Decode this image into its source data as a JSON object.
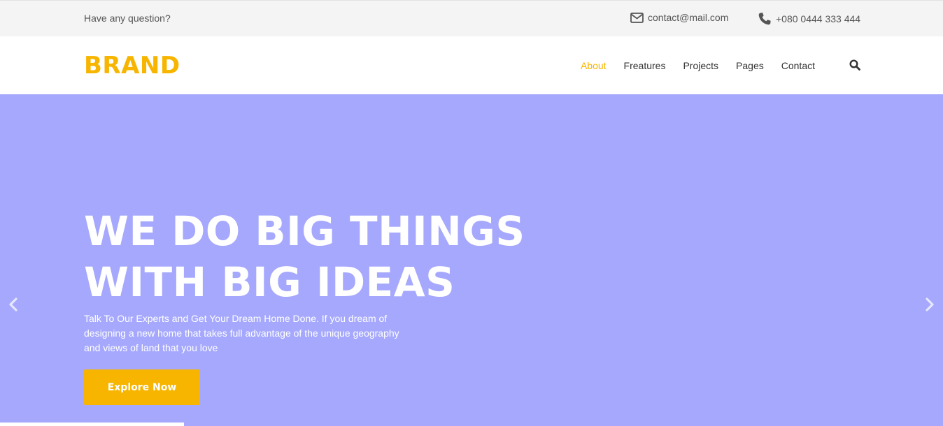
{
  "topbar": {
    "question": "Have any question?",
    "email": "contact@mail.com",
    "phone": "+080 0444 333 444",
    "icons": {
      "email": "envelope-icon",
      "phone": "phone-icon"
    }
  },
  "header": {
    "brand": "BRAND",
    "nav": [
      {
        "label": "About",
        "active": true
      },
      {
        "label": "Freatures",
        "active": false
      },
      {
        "label": "Projects",
        "active": false
      },
      {
        "label": "Pages",
        "active": false
      },
      {
        "label": "Contact",
        "active": false
      }
    ],
    "search_icon": "search-icon"
  },
  "hero": {
    "title_line1": "WE DO BIG THINGS",
    "title_line2": "WITH BIG IDEAS",
    "text": "Talk To Our Experts and Get Your Dream Home Done. If you dream of designing a new home that takes full advantage of the unique geography and views of land that you love",
    "cta_label": "Explore Now",
    "prev_icon": "chevron-left-icon",
    "next_icon": "chevron-right-icon"
  },
  "colors": {
    "accent": "#f7b500",
    "hero_bg": "#a5a8fd",
    "topbar_bg": "#f4f4f4",
    "text_dark": "#333333",
    "white": "#ffffff"
  }
}
